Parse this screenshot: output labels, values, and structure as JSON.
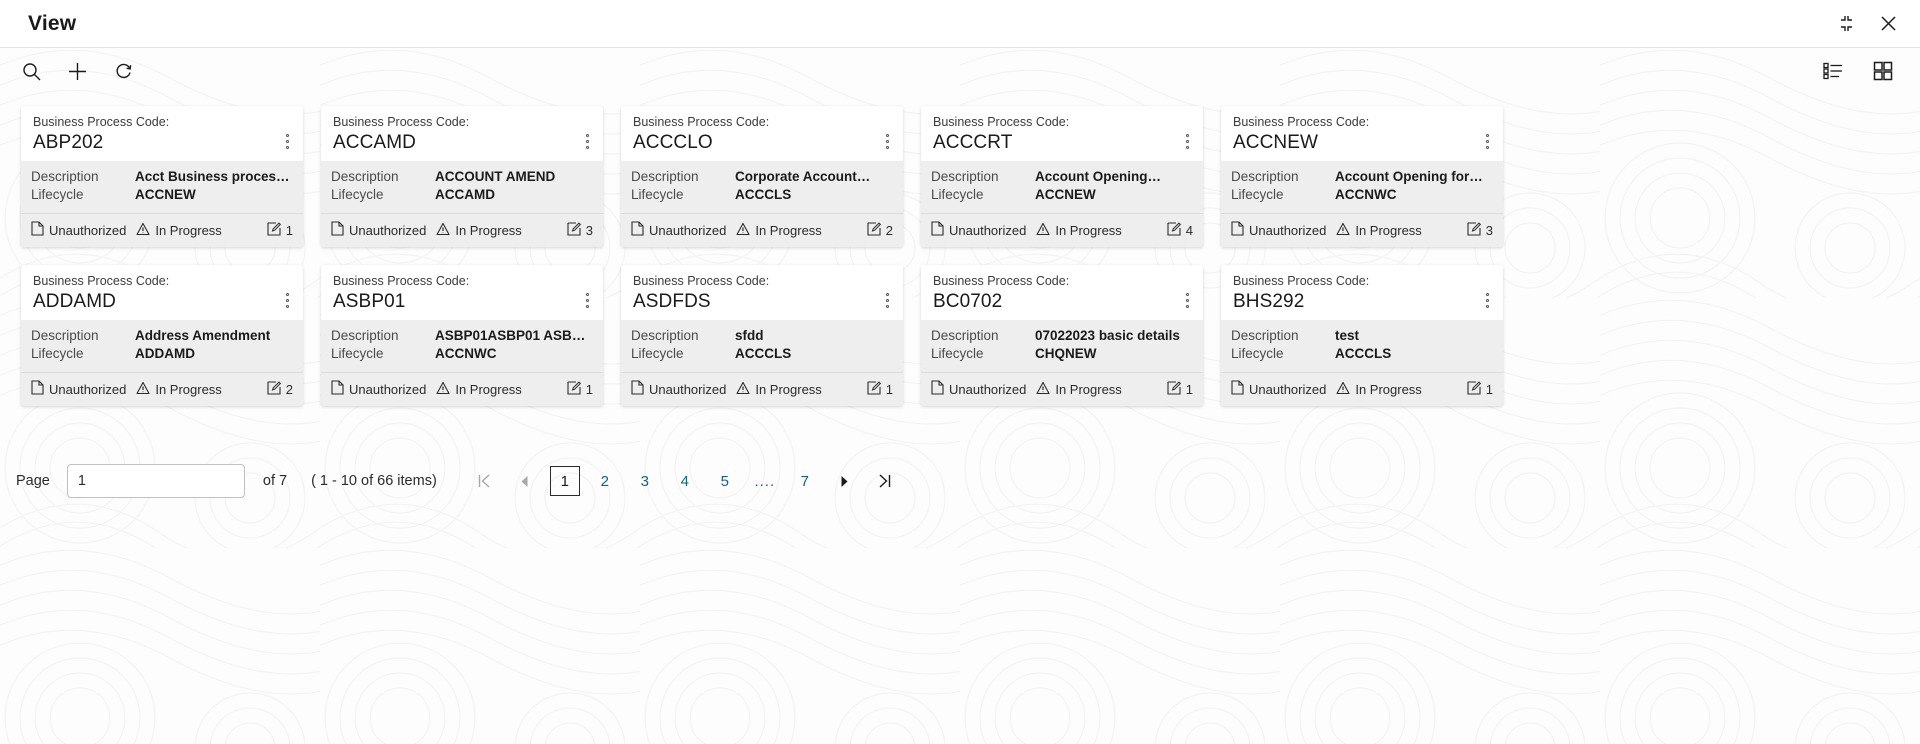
{
  "window": {
    "title": "View",
    "restore_icon": "collapse-icon",
    "close_icon": "close-icon"
  },
  "toolbar": {
    "search_icon": "search-icon",
    "add_icon": "plus-icon",
    "refresh_icon": "refresh-icon",
    "list_view_icon": "list-view-icon",
    "grid_view_icon": "grid-view-icon"
  },
  "card_labels": {
    "code_label": "Business Process Code:",
    "description_key": "Description",
    "lifecycle_key": "Lifecycle",
    "menu_icon": "kebab-menu-icon",
    "auth_icon": "document-icon",
    "status_icon": "warning-triangle-icon",
    "count_icon": "edit-icon"
  },
  "cards": [
    {
      "code": "ABP202",
      "description": "Acct Business proces…",
      "lifecycle": "ACCNEW",
      "authorization": "Unauthorized",
      "status": "In Progress",
      "count": "1"
    },
    {
      "code": "ACCAMD",
      "description": "ACCOUNT AMEND",
      "lifecycle": "ACCAMD",
      "authorization": "Unauthorized",
      "status": "In Progress",
      "count": "3"
    },
    {
      "code": "ACCCLO",
      "description": "Corporate Account…",
      "lifecycle": "ACCCLS",
      "authorization": "Unauthorized",
      "status": "In Progress",
      "count": "2"
    },
    {
      "code": "ACCCRT",
      "description": "Account Opening…",
      "lifecycle": "ACCNEW",
      "authorization": "Unauthorized",
      "status": "In Progress",
      "count": "4"
    },
    {
      "code": "ACCNEW",
      "description": "Account Opening for…",
      "lifecycle": "ACCNWC",
      "authorization": "Unauthorized",
      "status": "In Progress",
      "count": "3"
    },
    {
      "code": "ADDAMD",
      "description": "Address Amendment",
      "lifecycle": "ADDAMD",
      "authorization": "Unauthorized",
      "status": "In Progress",
      "count": "2"
    },
    {
      "code": "ASBP01",
      "description": "ASBP01ASBP01 ASBP…",
      "lifecycle": "ACCNWC",
      "authorization": "Unauthorized",
      "status": "In Progress",
      "count": "1"
    },
    {
      "code": "ASDFDS",
      "description": "sfdd",
      "lifecycle": "ACCCLS",
      "authorization": "Unauthorized",
      "status": "In Progress",
      "count": "1"
    },
    {
      "code": "BC0702",
      "description": "07022023 basic details",
      "lifecycle": "CHQNEW",
      "authorization": "Unauthorized",
      "status": "In Progress",
      "count": "1"
    },
    {
      "code": "BHS292",
      "description": "test",
      "lifecycle": "ACCCLS",
      "authorization": "Unauthorized",
      "status": "In Progress",
      "count": "1"
    }
  ],
  "pagination": {
    "page_label": "Page",
    "page_value": "1",
    "page_placeholder": "1",
    "of_text": "of 7",
    "range_text": "( 1 - 10 of 66 items)",
    "first_icon": "first-page-icon",
    "prev_icon": "previous-page-icon",
    "next_icon": "next-page-icon",
    "last_icon": "last-page-icon",
    "pages": [
      "1",
      "2",
      "3",
      "4",
      "5",
      "....",
      "7"
    ],
    "active_page": "1",
    "link_color": "#15647f"
  }
}
